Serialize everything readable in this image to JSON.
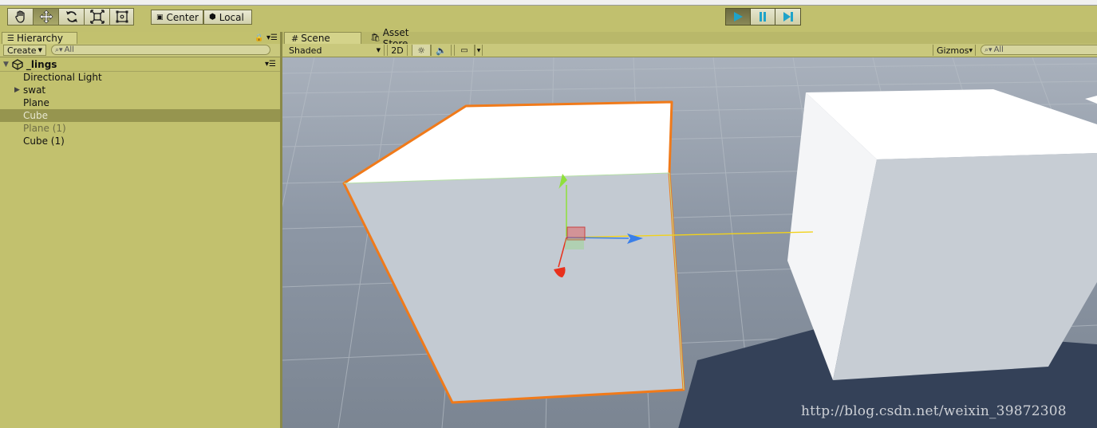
{
  "toolbar": {
    "tools": [
      {
        "name": "hand-tool",
        "active": false
      },
      {
        "name": "move-tool",
        "active": true
      },
      {
        "name": "rotate-tool",
        "active": false
      },
      {
        "name": "scale-tool",
        "active": false
      },
      {
        "name": "rect-tool",
        "active": false
      }
    ],
    "pivot_label": "Center",
    "space_label": "Local",
    "play_controls": [
      "play",
      "pause",
      "step"
    ]
  },
  "hierarchy": {
    "tab_label": "Hierarchy",
    "create_label": "Create",
    "search_placeholder": "All",
    "scene_name": "_lings",
    "items": [
      {
        "label": "Directional Light",
        "state": "normal",
        "expandable": false
      },
      {
        "label": "swat",
        "state": "normal",
        "expandable": true
      },
      {
        "label": "Plane",
        "state": "normal",
        "expandable": false
      },
      {
        "label": "Cube",
        "state": "selected",
        "expandable": false
      },
      {
        "label": "Plane (1)",
        "state": "inactive",
        "expandable": false
      },
      {
        "label": "Cube (1)",
        "state": "normal",
        "expandable": false
      }
    ]
  },
  "scene": {
    "tab_label": "Scene",
    "asset_store_label": "Asset Store",
    "shading_mode": "Shaded",
    "mode_2d_label": "2D",
    "gizmos_label": "Gizmos",
    "search_placeholder": "All"
  },
  "watermark": "http://blog.csdn.net/weixin_39872308",
  "colors": {
    "editor_bg": "#c2c16e",
    "selection": "#96954f",
    "selection_outline": "#f07a1a",
    "axis_x": "#e8301c",
    "axis_y": "#8fe03a",
    "axis_z": "#3a7fe8"
  }
}
